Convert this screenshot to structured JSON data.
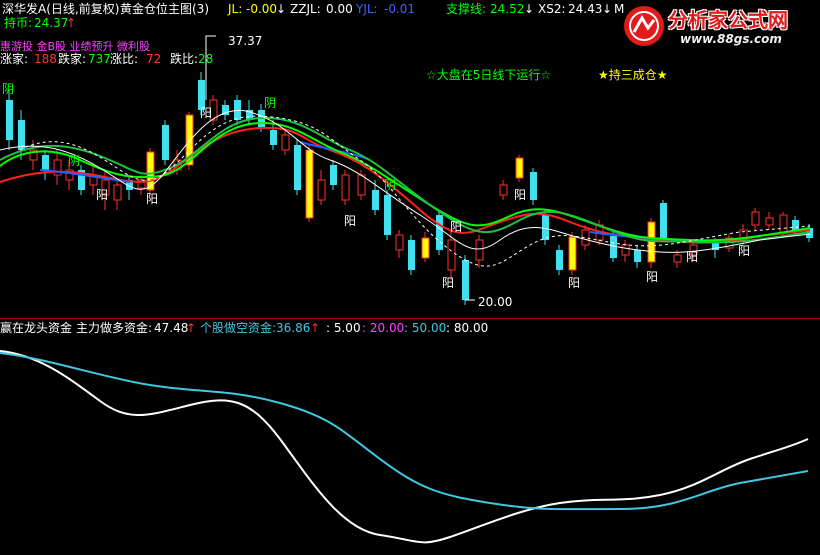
{
  "header": {
    "title": "深华发A(日线,前复权)",
    "indicator": "黄金仓位主图(3)",
    "jl_label": "JL:",
    "jl_value": "-0.00",
    "zzjl_label": "ZZJL:",
    "zzjl_value": "0.00",
    "yjl_label": "YJL:",
    "yjl_value": "-0.01",
    "support_label": "支撑线:",
    "support_value": "24.52",
    "xs2_label": "XS2:",
    "xs2_value": "24.43",
    "extra_label": "M"
  },
  "row2": {
    "label": "持币:",
    "value": "24.37"
  },
  "row3": {
    "tags": "惠游投 金B股 业绩预升 微利股"
  },
  "row4": {
    "up_label": "涨家:",
    "up_value": "188",
    "down_label": "跌家:",
    "down_value": "737",
    "ratio_label": "涨比:",
    "ratio_value": "72",
    "fall_label": "跌比:",
    "fall_value": "28"
  },
  "annotations": {
    "market_text": "☆大盘在5日线下运行☆",
    "position_text": "★持三成仓★",
    "high_price": "37.37",
    "low_price": "20.00"
  },
  "candle_labels": [
    "阴",
    "阳",
    "阴",
    "阳",
    "阳",
    "阴",
    "阳",
    "阳",
    "阴",
    "阳",
    "阳",
    "阳",
    "阳",
    "阳",
    "阳"
  ],
  "indicator_header": {
    "name": "赢在龙头资金",
    "main_label": "主力做多资金:",
    "main_value": "47.48",
    "stock_label": "个股做空资金:",
    "stock_value": "36.86",
    "levels": [
      ": 5.00",
      ": 20.00",
      ": 50.00",
      ": 80.00"
    ]
  },
  "logo": {
    "name": "分析家公式网",
    "url": "www.88gs.com"
  },
  "colors": {
    "up": "#ff3030",
    "down": "#40e0f0",
    "yellow": "#ffff00",
    "green": "#00ff00",
    "white": "#ffffff",
    "magenta": "#ff40ff",
    "cyan": "#40c8e0"
  }
}
